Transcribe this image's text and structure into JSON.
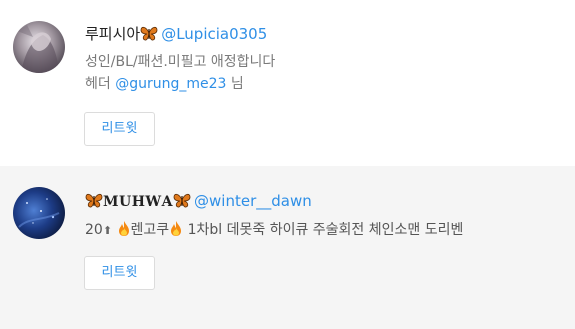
{
  "users": [
    {
      "display_name": "루피시아",
      "handle": "@Lupicia0305",
      "bio_line1": "성인/BL/패션.미필고 애정합니다",
      "bio_line2_prefix": "헤더 ",
      "bio_line2_mention": "@gurung_me23",
      "bio_line2_suffix": " 님",
      "button_label": "리트윗",
      "icons": [
        "butterfly-icon"
      ]
    },
    {
      "display_name": "𝐌𝐔𝐇𝐖𝐀",
      "handle": "@winter__dawn",
      "bio_part1": "20",
      "bio_part2": "렌고쿠",
      "bio_part3": "1차bl 데못죽 하이큐 주술회전 체인소맨 도리벤",
      "button_label": "리트윗",
      "icons": [
        "butterfly-icon",
        "fire-icon",
        "arrow-up-icon"
      ]
    }
  ],
  "colors": {
    "link": "#2f8fe6",
    "muted_text": "#7a7a7a",
    "alt_row_bg": "#f5f5f5",
    "button_border": "#dcdcdc"
  }
}
